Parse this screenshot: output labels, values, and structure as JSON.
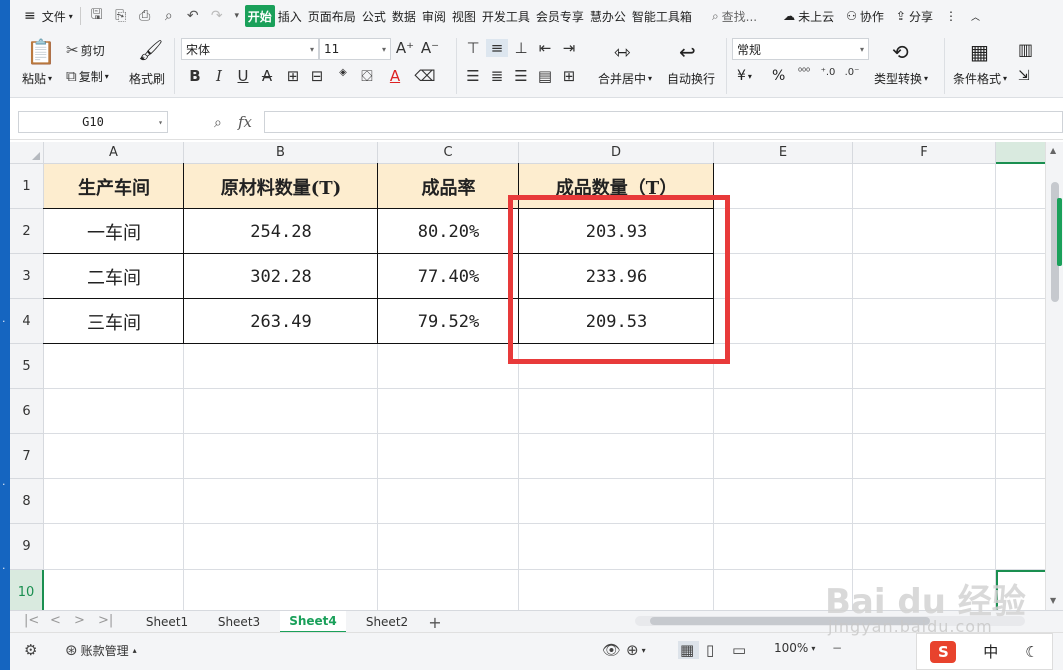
{
  "menubar": {
    "file": "文件",
    "tabs": [
      "开始",
      "插入",
      "页面布局",
      "公式",
      "数据",
      "审阅",
      "视图",
      "开发工具",
      "会员专享",
      "慧办公",
      "智能工具箱"
    ],
    "search": "查找...",
    "cloud": "未上云",
    "collab": "协作",
    "share": "分享"
  },
  "ribbon": {
    "paste": "粘贴",
    "cut": "剪切",
    "copy": "复制",
    "format_painter": "格式刷",
    "font_name": "宋体",
    "font_size": "11",
    "merge_center": "合并居中",
    "wrap_text": "自动换行",
    "number_format": "常规",
    "currency": "¥",
    "percent": "%",
    "type_convert": "类型转换",
    "cond_format": "条件格式"
  },
  "formula_bar": {
    "name_box": "G10",
    "fx": "fx",
    "value": ""
  },
  "grid": {
    "columns": [
      "A",
      "B",
      "C",
      "D",
      "E",
      "F"
    ],
    "rows": [
      "1",
      "2",
      "3",
      "4",
      "5",
      "6",
      "7",
      "8",
      "9",
      "10"
    ],
    "selected_row": "10",
    "table": {
      "header": [
        "生产车间",
        "原材料数量(T)",
        "成品率",
        "成品数量（T）"
      ],
      "rows": [
        [
          "一车间",
          "254.28",
          "80.20%",
          "203.93"
        ],
        [
          "二车间",
          "302.28",
          "77.40%",
          "233.96"
        ],
        [
          "三车间",
          "263.49",
          "79.52%",
          "209.53"
        ]
      ]
    }
  },
  "sheets": {
    "tabs": [
      "Sheet1",
      "Sheet3",
      "Sheet4",
      "Sheet2"
    ],
    "active": "Sheet4",
    "add": "+"
  },
  "statusbar": {
    "account": "账款管理",
    "zoom": "100%"
  },
  "ime": {
    "sogou": "S",
    "lang": "中"
  },
  "watermark": {
    "text": "Bai du 经验",
    "sub": "jingyan.baidu.com"
  },
  "colors": {
    "accent": "#1aa05a",
    "header_fill": "#fdedcf",
    "highlight": "#e83a3a"
  }
}
